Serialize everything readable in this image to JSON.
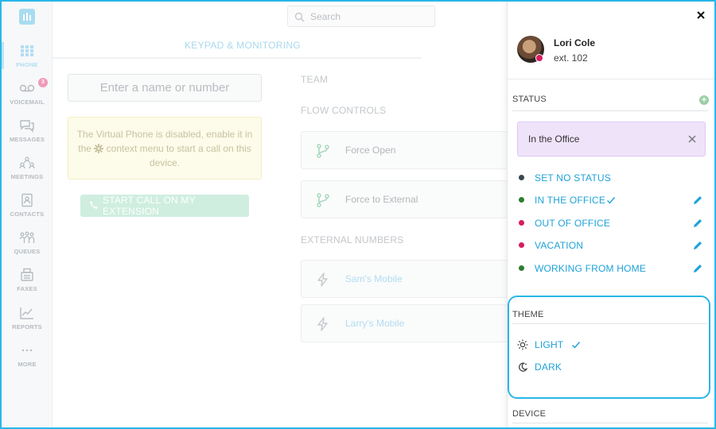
{
  "sidebar": {
    "items": [
      {
        "label": "PHONE",
        "icon": "phone-keypad-icon",
        "active": true
      },
      {
        "label": "VOICEMAIL",
        "icon": "voicemail-icon",
        "badge": "3"
      },
      {
        "label": "MESSAGES",
        "icon": "messages-icon"
      },
      {
        "label": "MEETINGS",
        "icon": "meetings-icon"
      },
      {
        "label": "CONTACTS",
        "icon": "contacts-icon"
      },
      {
        "label": "QUEUES",
        "icon": "queues-icon"
      },
      {
        "label": "FAXES",
        "icon": "fax-icon"
      },
      {
        "label": "REPORTS",
        "icon": "reports-icon"
      },
      {
        "label": "MORE",
        "icon": "more-icon"
      }
    ]
  },
  "search": {
    "placeholder": "Search"
  },
  "main": {
    "tab": "KEYPAD & MONITORING",
    "dial_placeholder": "Enter a name or number",
    "warning_before": "The Virtual Phone is disabled, enable it in the",
    "warning_after": "context menu to start a call on this device.",
    "start_call_label": "START CALL ON MY EXTENSION",
    "team_title": "TEAM",
    "flow_title": "FLOW CONTROLS",
    "flow_items": [
      "Force Open",
      "Force to External"
    ],
    "external_title": "EXTERNAL NUMBERS",
    "external_items": [
      "Sam's Mobile",
      "Larry's Mobile"
    ]
  },
  "panel": {
    "user": {
      "name": "Lori Cole",
      "ext": "ext. 102"
    },
    "status_title": "STATUS",
    "current_status": "In the Office",
    "status_options": [
      {
        "label": "SET NO STATUS",
        "color": "#37474f",
        "selected": false,
        "editable": false
      },
      {
        "label": "IN THE OFFICE",
        "color": "#2e7d32",
        "selected": true,
        "editable": true
      },
      {
        "label": "OUT OF OFFICE",
        "color": "#d81b60",
        "selected": false,
        "editable": true
      },
      {
        "label": "VACATION",
        "color": "#d81b60",
        "selected": false,
        "editable": true
      },
      {
        "label": "WORKING FROM HOME",
        "color": "#2e7d32",
        "selected": false,
        "editable": true
      }
    ],
    "theme_title": "THEME",
    "theme_options": [
      {
        "label": "LIGHT",
        "icon": "sun-icon",
        "selected": true
      },
      {
        "label": "DARK",
        "icon": "moon-icon",
        "selected": false
      }
    ],
    "device_title": "DEVICE"
  },
  "colors": {
    "accent": "#1ea2d9",
    "highlight_border": "#29b6e8"
  }
}
